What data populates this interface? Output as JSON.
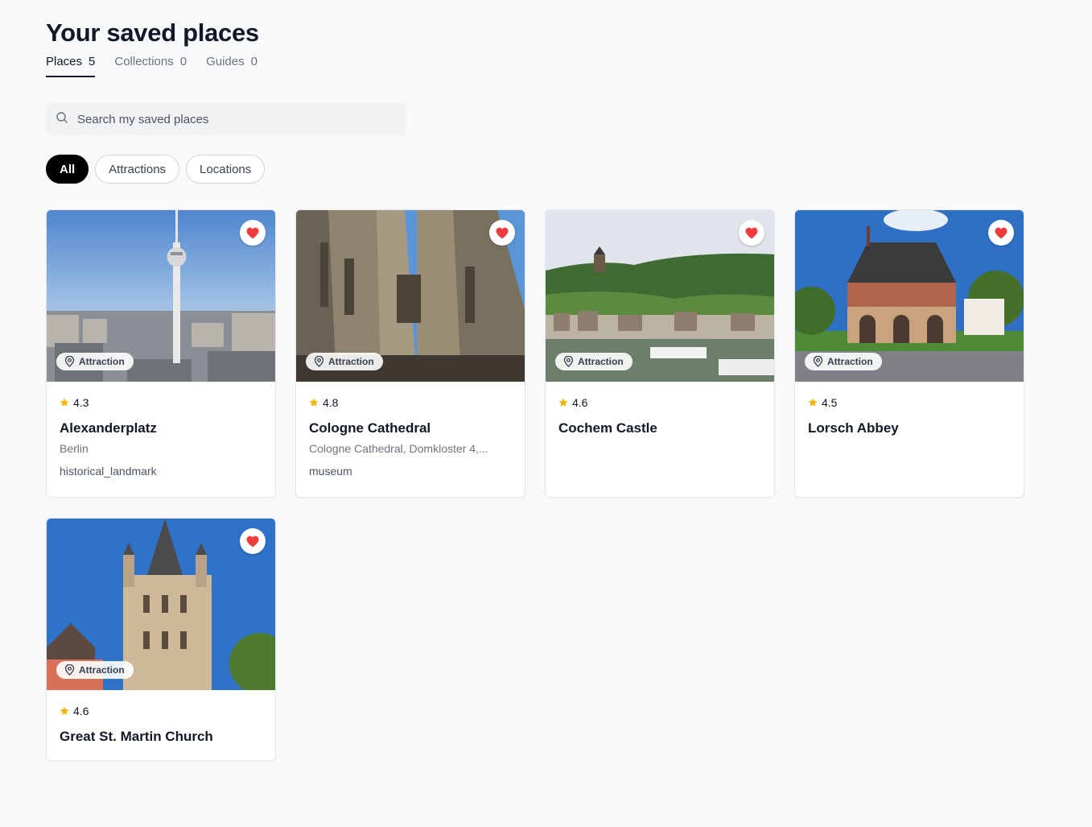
{
  "header": {
    "title": "Your saved places"
  },
  "tabs": [
    {
      "label": "Places",
      "count": "5"
    },
    {
      "label": "Collections",
      "count": "0"
    },
    {
      "label": "Guides",
      "count": "0"
    }
  ],
  "search": {
    "placeholder": "Search my saved places",
    "value": ""
  },
  "filters": [
    {
      "label": "All"
    },
    {
      "label": "Attractions"
    },
    {
      "label": "Locations"
    }
  ],
  "colors": {
    "heart": "#ef3b3b",
    "star": "#f5b300",
    "active_chip": "#000000"
  },
  "places": [
    {
      "name": "Alexanderplatz",
      "rating": "4.3",
      "address": "Berlin",
      "type": "historical_landmark",
      "badge": "Attraction"
    },
    {
      "name": "Cologne Cathedral",
      "rating": "4.8",
      "address": "Cologne Cathedral, Domkloster 4,...",
      "type": "museum",
      "badge": "Attraction"
    },
    {
      "name": "Cochem Castle",
      "rating": "4.6",
      "badge": "Attraction"
    },
    {
      "name": "Lorsch Abbey",
      "rating": "4.5",
      "badge": "Attraction"
    },
    {
      "name": "Great St. Martin Church",
      "rating": "4.6",
      "badge": "Attraction"
    }
  ]
}
